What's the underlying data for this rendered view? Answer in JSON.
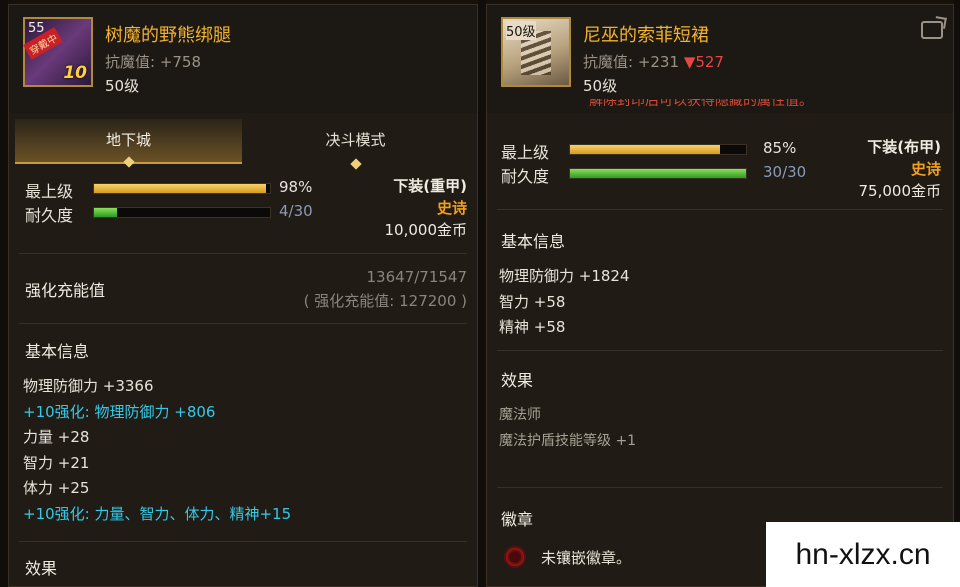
{
  "left_item": {
    "icon_level": "55",
    "icon_ribbon": "穿戴中",
    "icon_plus": "10",
    "name": "树魔的野熊绑腿",
    "magic_resist": "抗魔值: +758",
    "level": "50级",
    "tabs": [
      "地下城",
      "决斗模式"
    ],
    "bars": [
      {
        "label": "最上级",
        "value": "98%",
        "fill": 0.98,
        "kind": "gold"
      },
      {
        "label": "耐久度",
        "value": "4/30",
        "fill": 0.133,
        "kind": "green"
      }
    ],
    "type": "下装(重甲)",
    "rarity": "史诗",
    "price": "10,000金币",
    "charge_title": "强化充能值",
    "charge_value": "13647/71547",
    "charge_total": "( 强化充能值: 127200 )",
    "basic_title": "基本信息",
    "stats": [
      "物理防御力 +3366",
      "+10强化: 物理防御力 +806",
      "力量 +28",
      "智力 +21",
      "体力 +25",
      "+10强化: 力量、智力、体力、精神+15"
    ],
    "effect_title": "效果"
  },
  "right_item": {
    "icon_level": "50级",
    "name": "尼巫的索菲短裙",
    "magic_resist": "抗魔值: +231",
    "magic_resist_diff": "▼527",
    "level": "50级",
    "overlap_text": "解除封印后可以获得隐藏的属性值。",
    "bars": [
      {
        "label": "最上级",
        "value": "85%",
        "fill": 0.85,
        "kind": "gold"
      },
      {
        "label": "耐久度",
        "value": "30/30",
        "fill": 1.0,
        "kind": "green"
      }
    ],
    "type": "下装(布甲)",
    "rarity": "史诗",
    "price": "75,000金币",
    "basic_title": "基本信息",
    "stats": [
      "物理防御力 +1824",
      "智力 +58",
      "精神 +58"
    ],
    "effect_title": "效果",
    "effects": [
      "魔法师",
      "魔法护盾技能等级 +1"
    ],
    "emblem_title": "徽章",
    "emblem_text": "未镶嵌徽章。"
  },
  "watermark": "hn-xlzx.cn",
  "colors": {
    "gold": "#f2b22e",
    "rarity": "#f2a01e",
    "cyan": "#35c9e8",
    "down": "#e64646"
  }
}
